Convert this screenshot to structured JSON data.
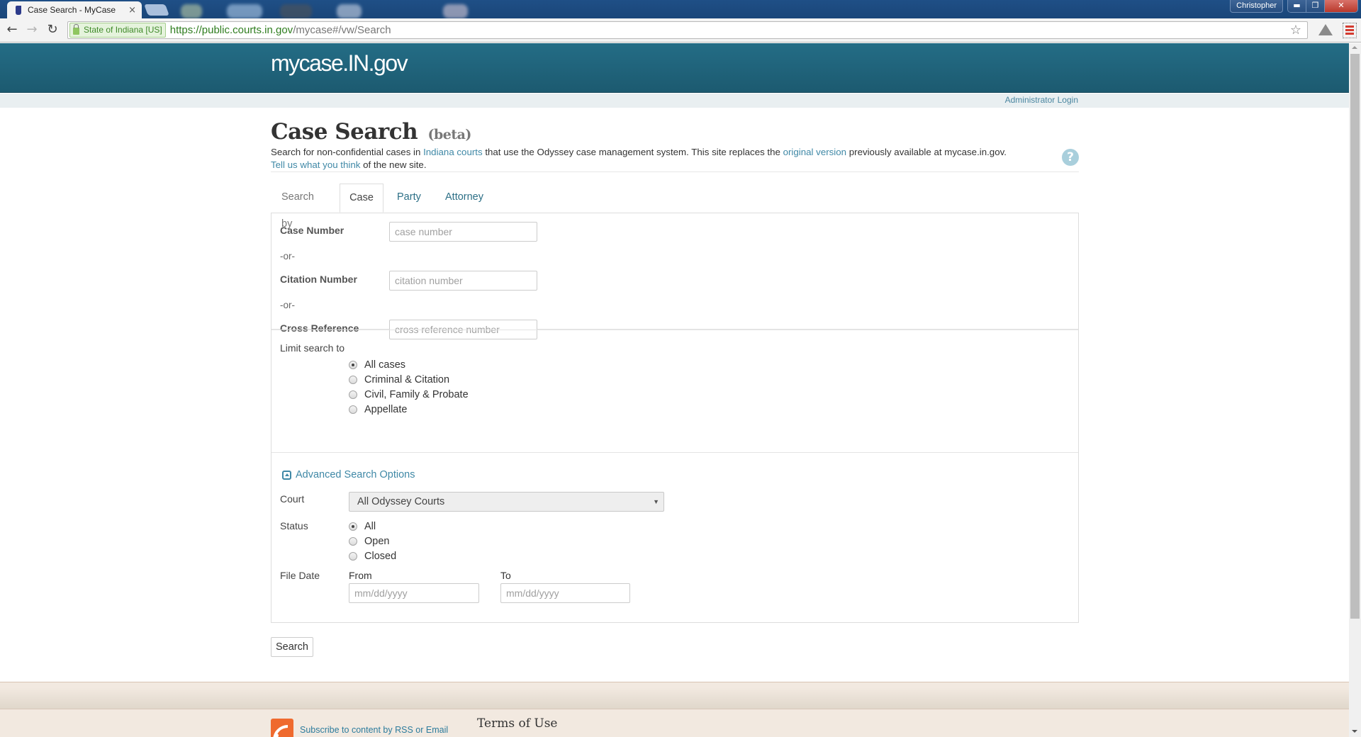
{
  "browser": {
    "tab_title": "Case Search - MyCase",
    "tab_close": "×",
    "user_name": "Christopher",
    "window_buttons": {
      "minimize": "▬",
      "restore": "❐",
      "close": "✕"
    },
    "nav": {
      "back": "←",
      "forward": "→",
      "reload": "↻"
    },
    "ev_cert": "State of Indiana [US]",
    "url_host": "https://public.courts.in.gov",
    "url_path": "/mycase#/vw/Search",
    "bookmark_icon": "☆"
  },
  "site": {
    "logo": "mycase.IN.gov",
    "admin_login": "Administrator Login"
  },
  "page": {
    "title": "Case Search",
    "title_suffix": "(beta)",
    "intro": {
      "t1": "Search for non-confidential cases in ",
      "link1": "Indiana courts",
      "t2": " that use the Odyssey case management system. This site replaces the ",
      "link2": "original version",
      "t3": " previously available at mycase.in.gov.",
      "link3": "Tell us what you think",
      "t4": " of the new site."
    },
    "help_icon": "?"
  },
  "tabs": {
    "label": "Search by",
    "items": [
      {
        "label": "Case",
        "active": true
      },
      {
        "label": "Party",
        "active": false
      },
      {
        "label": "Attorney",
        "active": false
      }
    ]
  },
  "case_fields": {
    "case_number": {
      "label": "Case Number",
      "placeholder": "case number",
      "value": ""
    },
    "or1": "-or-",
    "citation_number": {
      "label": "Citation Number",
      "placeholder": "citation number",
      "value": ""
    },
    "or2": "-or-",
    "cross_reference": {
      "label": "Cross Reference",
      "placeholder": "cross reference number",
      "value": ""
    }
  },
  "limit": {
    "label": "Limit search to",
    "options": [
      {
        "label": "All cases",
        "selected": true
      },
      {
        "label": "Criminal & Citation",
        "selected": false
      },
      {
        "label": "Civil, Family & Probate",
        "selected": false
      },
      {
        "label": "Appellate",
        "selected": false
      }
    ]
  },
  "advanced": {
    "toggle_label": "Advanced Search Options",
    "court": {
      "label": "Court",
      "selected": "All Odyssey Courts",
      "arrow": "▼"
    },
    "status": {
      "label": "Status",
      "options": [
        {
          "label": "All",
          "selected": true
        },
        {
          "label": "Open",
          "selected": false
        },
        {
          "label": "Closed",
          "selected": false
        }
      ]
    },
    "file_date": {
      "label": "File Date",
      "from_label": "From",
      "from_placeholder": "mm/dd/yyyy",
      "to_label": "To",
      "to_placeholder": "mm/dd/yyyy"
    }
  },
  "search_button": "Search",
  "footer": {
    "rss_link": "Subscribe to content by RSS or Email",
    "terms_heading": "Terms of Use"
  },
  "colors": {
    "header": "#1f6379",
    "link": "#3f88a6",
    "footer_bg": "#f2e9e0"
  }
}
